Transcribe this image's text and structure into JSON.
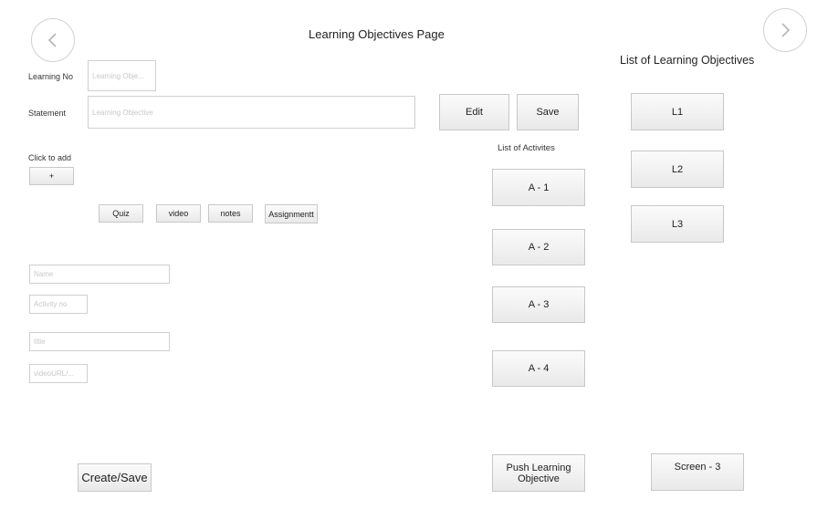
{
  "page": {
    "title": "Learning Objectives Page",
    "back_icon": "chevron-left-icon",
    "forward_icon": "chevron-right-icon"
  },
  "form": {
    "learning_no_label": "Learning No",
    "learning_no_placeholder": "Learning Obje...",
    "statement_label": "Statement",
    "statement_placeholder": "Learning Objective",
    "click_to_add_label": "Click to add",
    "add_button": "+"
  },
  "activity_types": [
    "Quiz",
    "video",
    "notes",
    "Assignmentt"
  ],
  "fields": {
    "name_placeholder": "Name",
    "activity_placeholder": "Activity no",
    "title_placeholder": "title",
    "url_placeholder": "videoURL/..."
  },
  "actions": {
    "edit": "Edit",
    "save": "Save",
    "create_save": "Create/Save",
    "push_line1": "Push Learning",
    "push_line2": "Objective",
    "screen3": "Screen - 3"
  },
  "activities": {
    "heading": "List of Activites",
    "items": [
      "A - 1",
      "A - 2",
      "A - 3",
      "A - 4"
    ]
  },
  "objectives": {
    "heading": "List of Learning Objectives",
    "items": [
      "L1",
      "L2",
      "L3"
    ]
  }
}
